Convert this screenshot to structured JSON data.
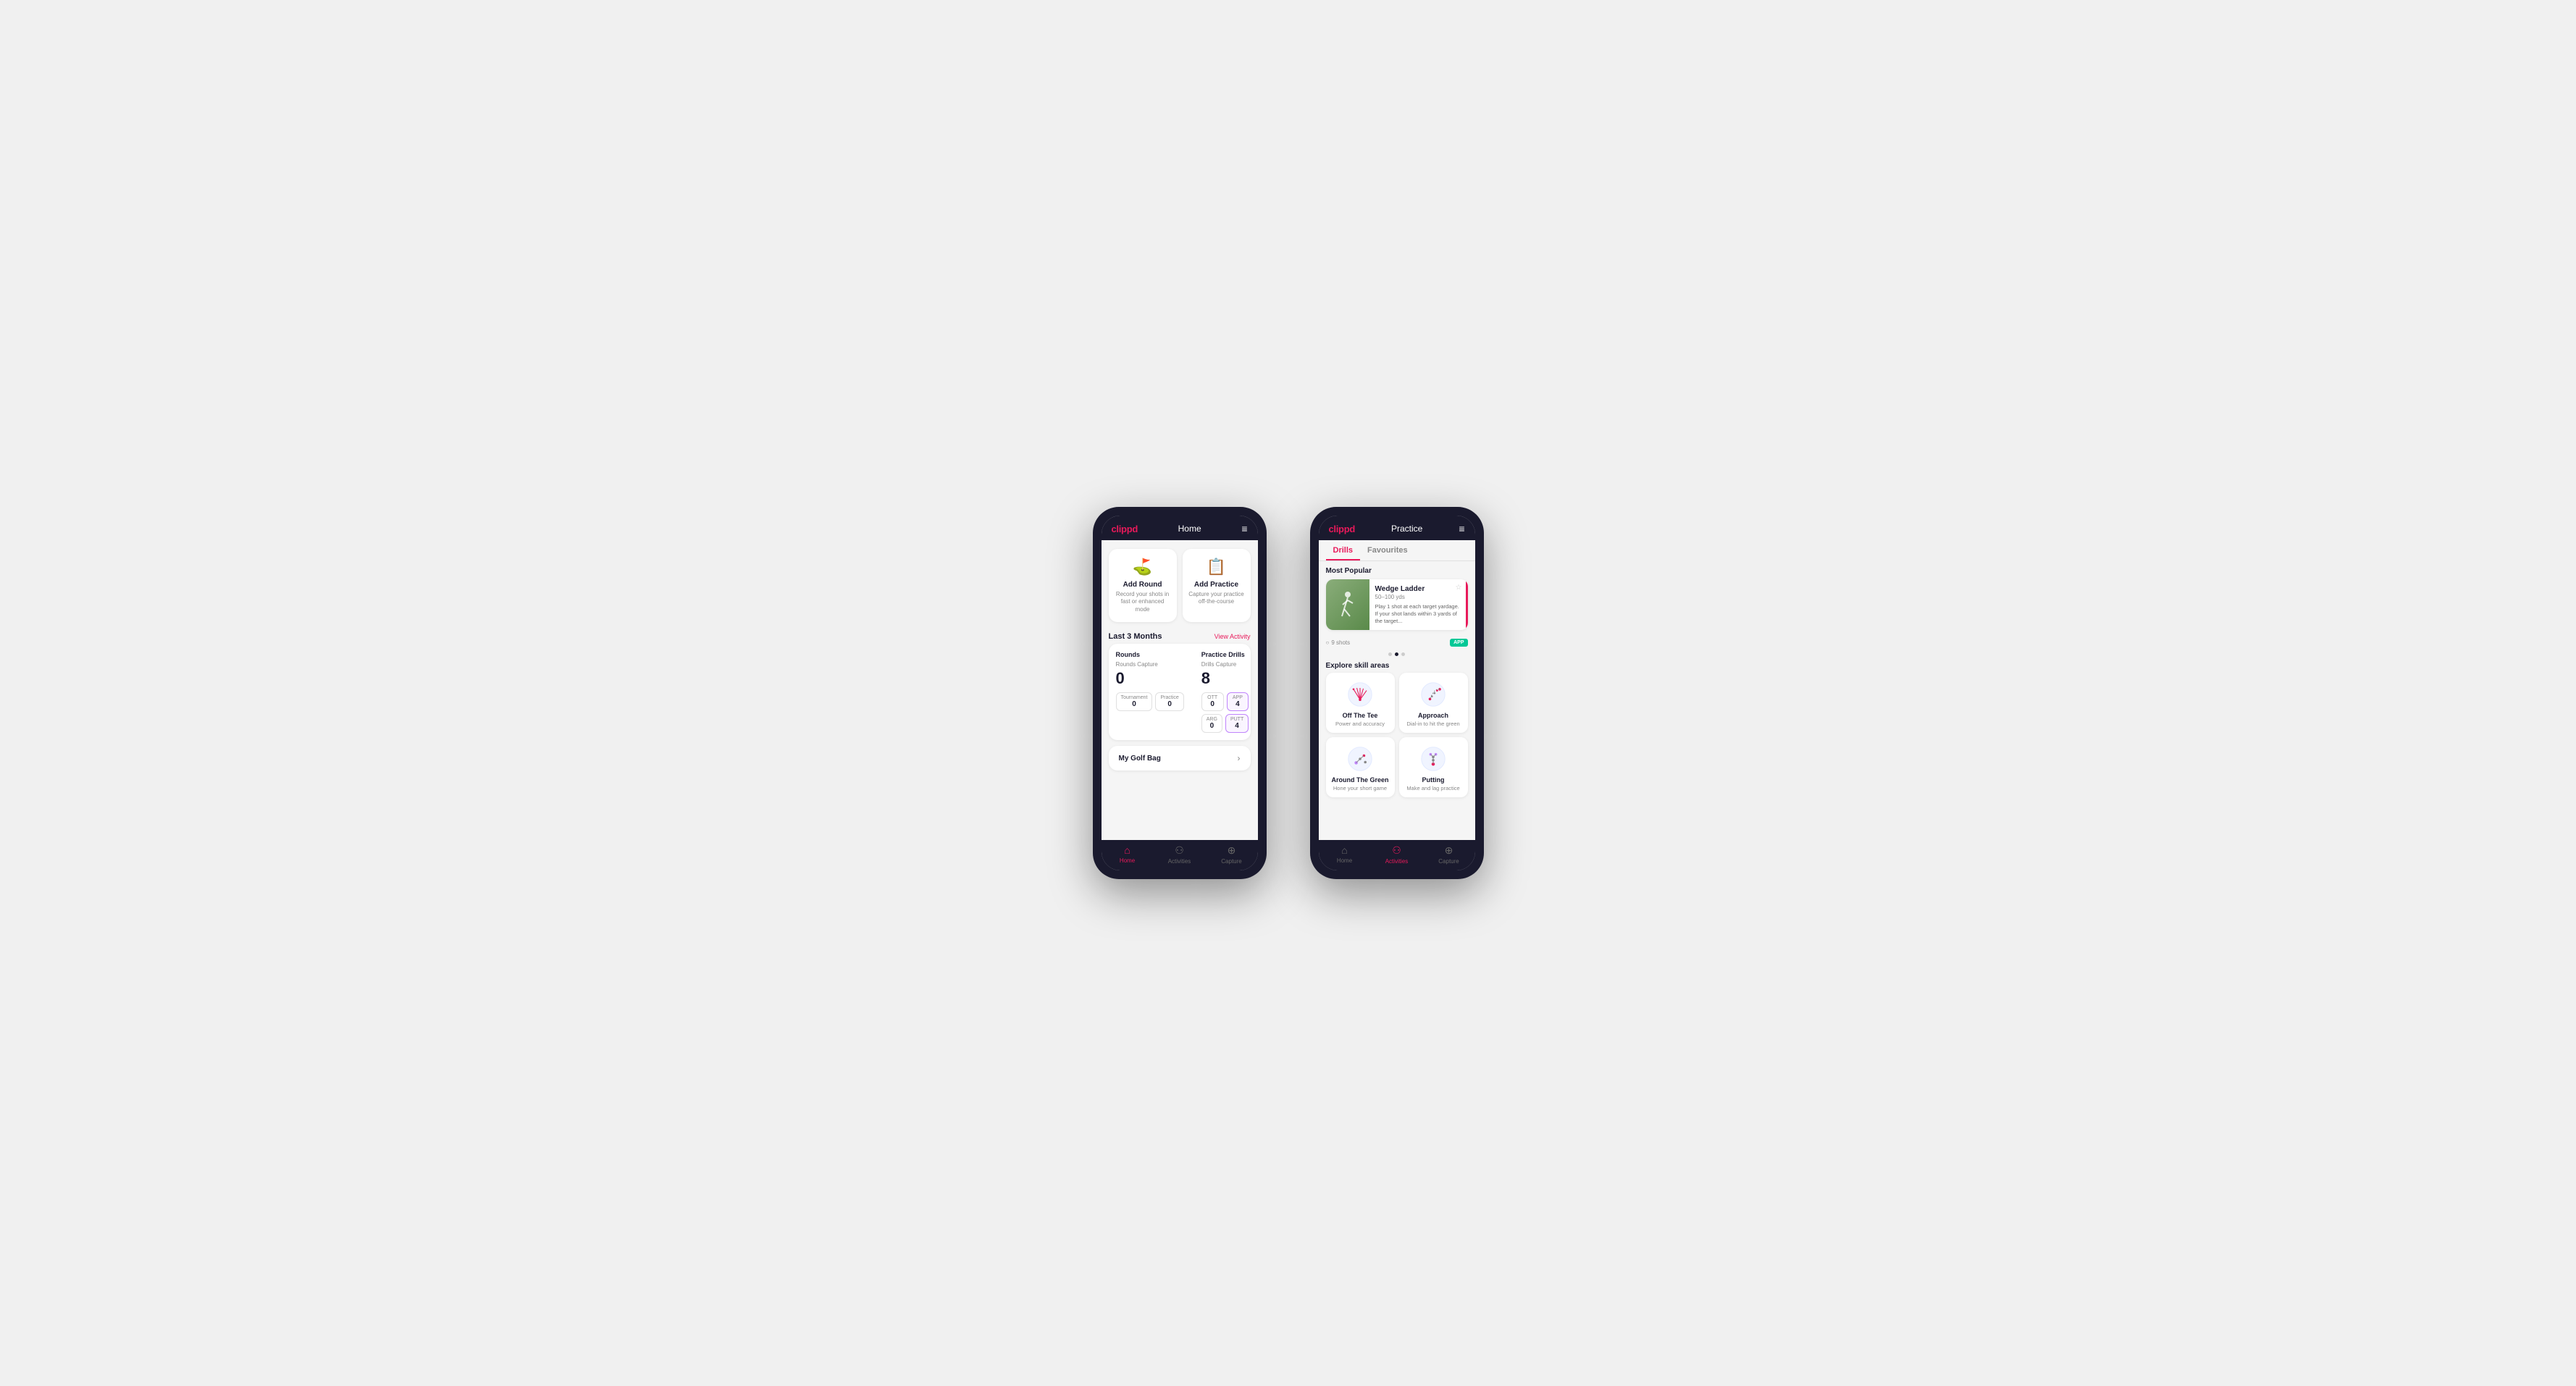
{
  "phone1": {
    "brand": "clippd",
    "topbar_title": "Home",
    "action_cards": [
      {
        "id": "add-round",
        "icon": "⛳",
        "title": "Add Round",
        "desc": "Record your shots in fast or enhanced mode"
      },
      {
        "id": "add-practice",
        "icon": "📋",
        "title": "Add Practice",
        "desc": "Capture your practice off-the-course"
      }
    ],
    "last3months_label": "Last 3 Months",
    "view_activity_label": "View Activity",
    "rounds_label": "Rounds",
    "practice_drills_label": "Practice Drills",
    "rounds_capture_label": "Rounds Capture",
    "drills_capture_label": "Drills Capture",
    "rounds_count": "0",
    "drills_count": "8",
    "tournament_label": "Tournament",
    "practice_label": "Practice",
    "tournament_value": "0",
    "practice_value": "0",
    "ott_label": "OTT",
    "app_label": "APP",
    "arg_label": "ARG",
    "putt_label": "PUTT",
    "ott_value": "0",
    "app_value": "4",
    "arg_value": "0",
    "putt_value": "4",
    "golf_bag_label": "My Golf Bag",
    "nav": [
      {
        "id": "home",
        "icon": "🏠",
        "label": "Home",
        "active": true
      },
      {
        "id": "activities",
        "icon": "♟",
        "label": "Activities",
        "active": false
      },
      {
        "id": "capture",
        "icon": "➕",
        "label": "Capture",
        "active": false
      }
    ]
  },
  "phone2": {
    "brand": "clippd",
    "topbar_title": "Practice",
    "tabs": [
      {
        "id": "drills",
        "label": "Drills",
        "active": true
      },
      {
        "id": "favourites",
        "label": "Favourites",
        "active": false
      }
    ],
    "most_popular_label": "Most Popular",
    "drill_card": {
      "title": "Wedge Ladder",
      "yardage": "50–100 yds",
      "desc": "Play 1 shot at each target yardage. If your shot lands within 3 yards of the target...",
      "shots": "9 shots",
      "badge": "APP"
    },
    "dots": [
      {
        "active": false
      },
      {
        "active": true
      },
      {
        "active": false
      }
    ],
    "explore_label": "Explore skill areas",
    "skill_areas": [
      {
        "id": "off-the-tee",
        "name": "Off The Tee",
        "desc": "Power and accuracy",
        "icon_type": "tee"
      },
      {
        "id": "approach",
        "name": "Approach",
        "desc": "Dial-in to hit the green",
        "icon_type": "approach"
      },
      {
        "id": "around-the-green",
        "name": "Around The Green",
        "desc": "Hone your short game",
        "icon_type": "atg"
      },
      {
        "id": "putting",
        "name": "Putting",
        "desc": "Make and lag practice",
        "icon_type": "putting"
      }
    ],
    "nav": [
      {
        "id": "home",
        "icon": "🏠",
        "label": "Home",
        "active": false
      },
      {
        "id": "activities",
        "icon": "♟",
        "label": "Activities",
        "active": true
      },
      {
        "id": "capture",
        "icon": "➕",
        "label": "Capture",
        "active": false
      }
    ]
  }
}
